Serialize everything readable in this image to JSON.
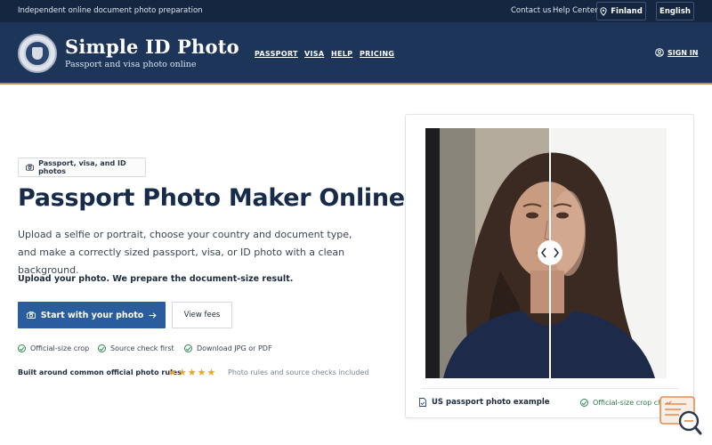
{
  "topbar": {
    "tagline": "Independent online document photo preparation",
    "contact": "Contact us",
    "help": "Help Center",
    "country": "Finland",
    "language": "English"
  },
  "header": {
    "brand_title": "Simple ID Photo",
    "brand_subtitle": "Passport and visa photo online",
    "nav": [
      "PASSPORT",
      "VISA",
      "HELP",
      "PRICING"
    ],
    "sign_in": "SIGN IN"
  },
  "hero": {
    "badge": "Passport, visa, and ID photos",
    "title": "Passport Photo Maker Online",
    "lead": "Upload a selfie or portrait, choose your country and document type, and make a correctly sized passport, visa, or ID photo with a clean background.",
    "upload_note": "Upload your photo. We prepare the document-size result.",
    "primary_button": "Start with your photo",
    "secondary_button": "View fees",
    "features": [
      "Official-size crop",
      "Source check first",
      "Download JPG or PDF"
    ],
    "rules_label": "Built around common official photo rules",
    "rating_stars": 5,
    "rules_sub": "Photo rules and source checks included"
  },
  "preview": {
    "caption": "US passport photo example",
    "status": "Official-size crop checked"
  },
  "colors": {
    "navy": "#1c3558",
    "topbar": "#142640",
    "accent_button": "#2a5d9e",
    "gold": "#b89a4a",
    "check_green": "#2d8a4e",
    "star": "#e2a82a"
  }
}
